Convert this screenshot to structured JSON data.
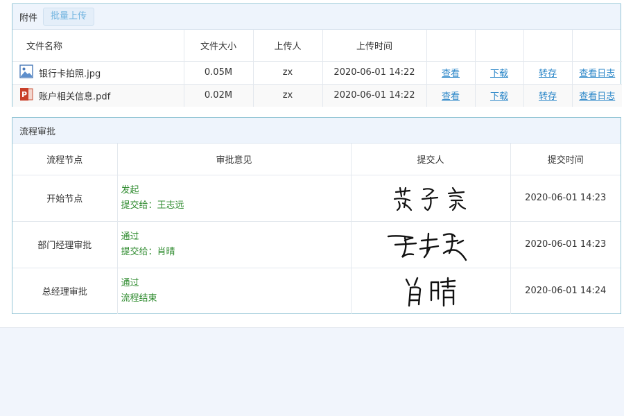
{
  "attachments": {
    "title": "附件",
    "batch_upload_label": "批量上传",
    "columns": [
      "文件名称",
      "文件大小",
      "上传人",
      "上传时间"
    ],
    "files": [
      {
        "icon": "image-file-icon",
        "name": "银行卡拍照.jpg",
        "size": "0.05M",
        "uploader": "zx",
        "time": "2020-06-01 14:22",
        "actions": [
          "查看",
          "下载",
          "转存",
          "查看日志"
        ]
      },
      {
        "icon": "powerpoint-file-icon",
        "name": "账户相关信息.pdf",
        "size": "0.02M",
        "uploader": "zx",
        "time": "2020-06-01 14:22",
        "actions": [
          "查看",
          "下载",
          "转存",
          "查看日志"
        ]
      }
    ]
  },
  "approval": {
    "title": "流程审批",
    "columns": [
      "流程节点",
      "审批意见",
      "提交人",
      "提交时间"
    ],
    "rows": [
      {
        "node": "开始节点",
        "opinion_line1": "发起",
        "opinion_line2": "提交给：王志远",
        "signature": "范子豪",
        "time": "2020-06-01 14:23"
      },
      {
        "node": "部门经理审批",
        "opinion_line1": "通过",
        "opinion_line2": "提交给：肖晴",
        "signature": "王志远",
        "time": "2020-06-01 14:23"
      },
      {
        "node": "总经理审批",
        "opinion_line1": "通过",
        "opinion_line2": "流程结束",
        "signature": "肖晴",
        "time": "2020-06-01 14:24"
      }
    ]
  },
  "colors": {
    "link": "#2a86c8",
    "opinion_text": "#2d8a2d",
    "panel_border": "#95c6d6",
    "header_bg": "#eef4fc"
  }
}
